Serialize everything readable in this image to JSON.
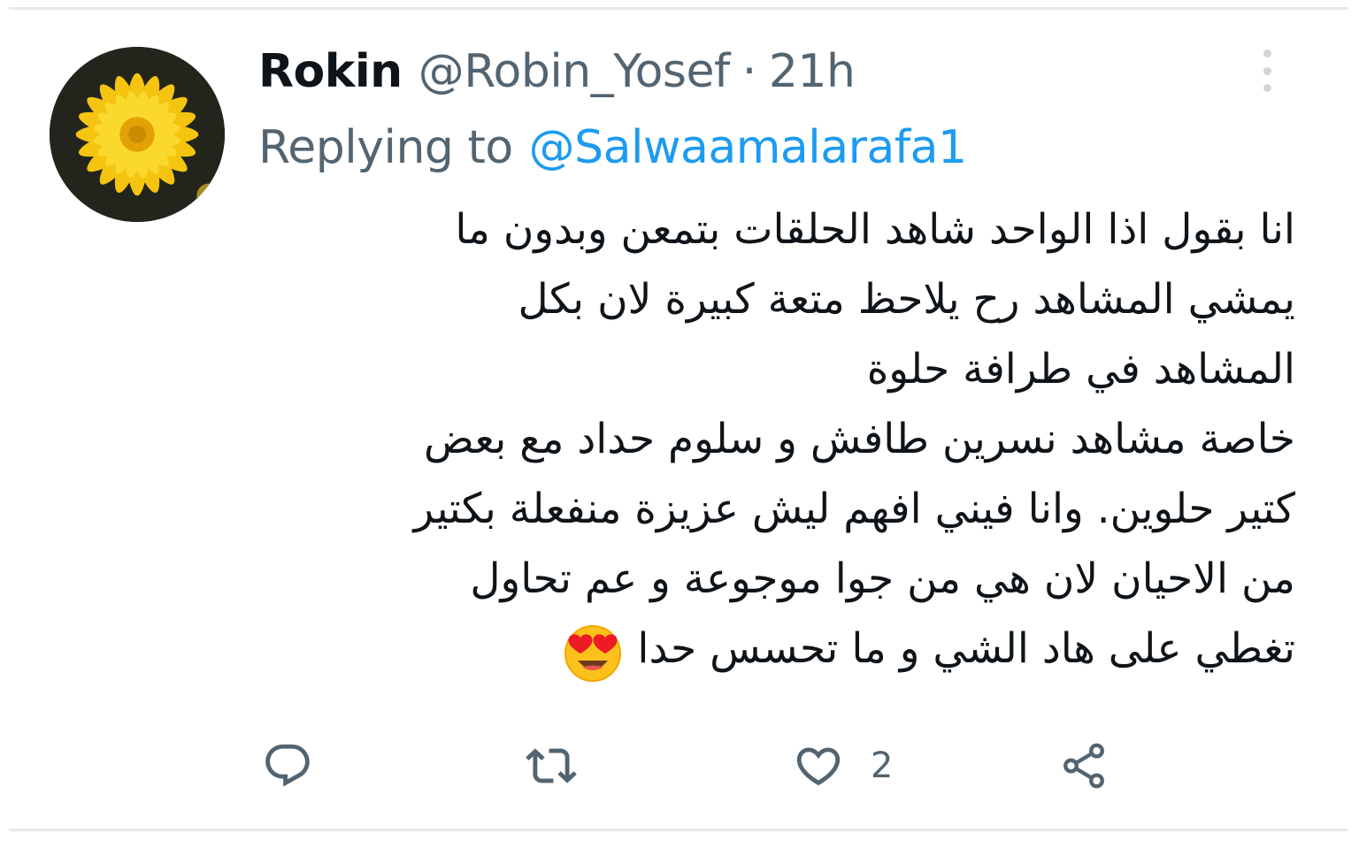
{
  "tweet": {
    "author_name": "Rokin",
    "author_handle": "@Robin_Yosef",
    "separator": "·",
    "timestamp": "21h",
    "replying_label": "Replying to",
    "replying_to": "@Salwaamalarafa1",
    "text_lines": [
      "انا بقول اذا الواحد شاهد الحلقات بتمعن وبدون ما",
      "يمشي المشاهد رح يلاحظ متعة كبيرة لان بكل",
      "المشاهد في طرافة حلوة",
      "خاصة مشاهد نسرين طافش و سلوم حداد مع بعض",
      "كتير حلوين. وانا فيني افهم ليش عزيزة منفعلة بكتير",
      "من الاحيان لان هي من جوا موجوعة و عم تحاول",
      "تغطي على هاد الشي و ما تحسس حدا"
    ],
    "emoji": "smiling-face-with-heart-eyes",
    "like_count": "2"
  },
  "icons": {
    "avatar": "yellow-flower-avatar",
    "more": "more-vertical-icon",
    "reply": "reply-bubble-icon",
    "retweet": "retweet-icon",
    "like": "heart-icon",
    "share": "share-icon"
  },
  "colors": {
    "text": "#0f1419",
    "secondary": "#536471",
    "link": "#1d9bf0",
    "divider": "#e6e9ec"
  }
}
